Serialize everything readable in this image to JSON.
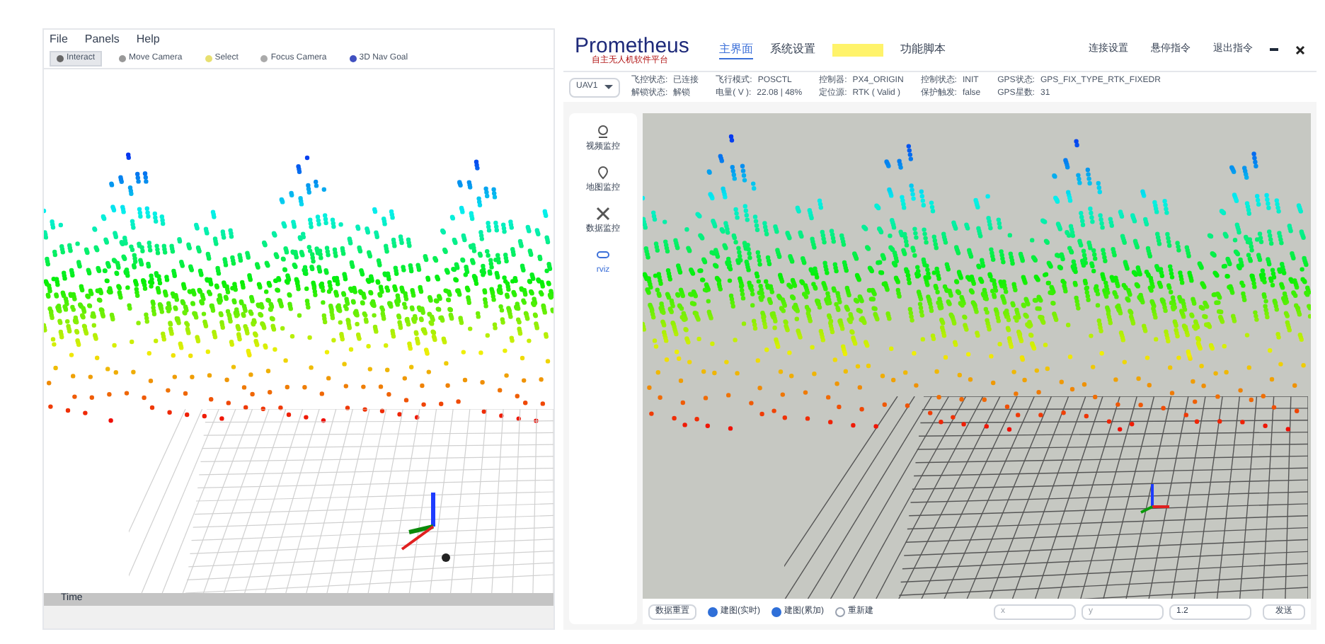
{
  "rviz": {
    "menu": [
      "File",
      "Panels",
      "Help"
    ],
    "tools": [
      {
        "label": "Interact",
        "kind": "interact",
        "selected": true
      },
      {
        "label": "Move Camera",
        "kind": "move",
        "selected": false
      },
      {
        "label": "Select",
        "kind": "select",
        "selected": false
      },
      {
        "label": "Focus Camera",
        "kind": "focus",
        "selected": false
      },
      {
        "label": "3D Nav Goal",
        "kind": "goal",
        "selected": false
      }
    ],
    "time_panel": {
      "title": "Time"
    }
  },
  "prometheus": {
    "logo": "Prometheus",
    "logo_sub": "自主无人机软件平台",
    "nav": [
      {
        "label": "主界面",
        "selected": true
      },
      {
        "label": "系统设置",
        "selected": false
      },
      {
        "selected": false,
        "highlighted": true
      },
      {
        "label": "功能脚本",
        "selected": false
      }
    ],
    "actions": [
      "连接设置",
      "悬停指令",
      "退出指令"
    ],
    "vehicle": "UAV1",
    "status": [
      {
        "label": "飞控状态:",
        "value": "已连接"
      },
      {
        "label": "解锁状态:",
        "value": "解锁"
      },
      {
        "label": "飞行模式:",
        "value": "POSCTL"
      },
      {
        "label": "电量( V ):",
        "value": "22.08 | 48%"
      },
      {
        "label": "控制器:",
        "value": "PX4_ORIGIN"
      },
      {
        "label": "定位源:",
        "value": "RTK ( Valid )"
      },
      {
        "label": "控制状态:",
        "value": "INIT"
      },
      {
        "label": "保护触发:",
        "value": "false"
      },
      {
        "label": "GPS状态:",
        "value": "GPS_FIX_TYPE_RTK_FIXEDR"
      },
      {
        "label": "GPS星数:",
        "value": "31"
      }
    ],
    "sidebar": [
      {
        "label": "视频监控",
        "kind": "video",
        "selected": false
      },
      {
        "label": "地图监控",
        "kind": "map",
        "selected": false
      },
      {
        "label": "数据监控",
        "kind": "data",
        "selected": false
      },
      {
        "label": "rviz",
        "kind": "rviz",
        "selected": true
      }
    ],
    "bottom": {
      "reset": "数据重置",
      "checks": [
        {
          "label": "建图(实时)",
          "checked": true
        },
        {
          "label": "建图(累加)",
          "checked": true
        },
        {
          "label": "重新建",
          "checked": false
        }
      ],
      "inputs": [
        {
          "placeholder": "x"
        },
        {
          "placeholder": "y"
        },
        {
          "value": "1.2"
        }
      ],
      "send": "发送"
    }
  }
}
